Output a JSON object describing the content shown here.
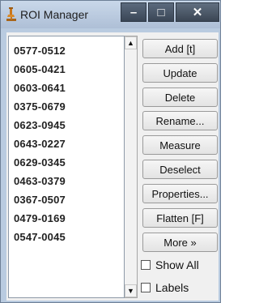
{
  "window": {
    "title": "ROI Manager",
    "minimize_glyph": "–",
    "maximize_glyph": "□",
    "close_glyph": "✕"
  },
  "roi_list": [
    "0577-0512",
    "0605-0421",
    "0603-0641",
    "0375-0679",
    "0623-0945",
    "0643-0227",
    "0629-0345",
    "0463-0379",
    "0367-0507",
    "0479-0169",
    "0547-0045"
  ],
  "scrollbar": {
    "up_glyph": "▲",
    "down_glyph": "▼"
  },
  "buttons": {
    "add": "Add [t]",
    "update": "Update",
    "delete": "Delete",
    "rename": "Rename...",
    "measure": "Measure",
    "deselect": "Deselect",
    "properties": "Properties...",
    "flatten": "Flatten [F]",
    "more": "More »"
  },
  "checkboxes": {
    "show_all": {
      "label": "Show All",
      "checked": false
    },
    "labels": {
      "label": "Labels",
      "checked": false
    }
  }
}
